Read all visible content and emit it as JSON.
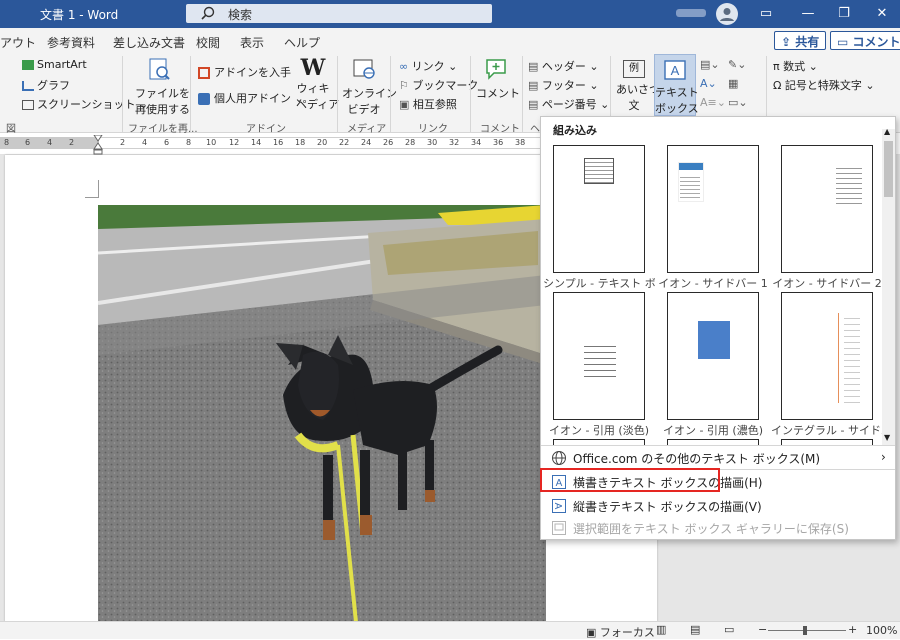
{
  "title": "文書 1 - Word",
  "search_placeholder": "検索",
  "window_buttons": [
    "▭",
    "—",
    "❐",
    "✕"
  ],
  "tabs": [
    "アウト",
    "参考資料",
    "差し込み文書",
    "校閲",
    "表示",
    "ヘルプ"
  ],
  "share_label": "共有",
  "comment_label": "コメント",
  "ribbon": {
    "smartart": "SmartArt",
    "graph": "グラフ",
    "screenshot": "スクリーンショット",
    "reuse_file": [
      "ファイルを",
      "再使用する"
    ],
    "get_addins": "アドインを入手",
    "my_addins": "個人用アドイン",
    "wikipedia": [
      "ウィキ",
      "ペディア"
    ],
    "online_video": [
      "オンライン",
      "ビデオ"
    ],
    "link": "リンク",
    "bookmark": "ブックマーク",
    "crossref": "相互参照",
    "comment": "コメント",
    "header": "ヘッダー",
    "footer": "フッター",
    "page_number": "ページ番号",
    "greeting": [
      "あいさつ",
      "文"
    ],
    "textbox": [
      "テキスト",
      "ボックス"
    ],
    "equation": "数式",
    "symbol": "記号と特殊文字",
    "groups": [
      "図",
      "ファイルを再...",
      "アドイン",
      "メディア",
      "リンク",
      "コメント",
      "ヘ"
    ]
  },
  "ruler_numbers": [
    "8",
    "6",
    "4",
    "2",
    "2",
    "4",
    "6",
    "8",
    "10",
    "12",
    "14",
    "16",
    "18",
    "20",
    "22",
    "24",
    "26",
    "28",
    "30",
    "32",
    "34",
    "36",
    "38"
  ],
  "gallery": {
    "heading": "組み込み",
    "items": [
      "シンプル - テキスト ボックス",
      "イオン - サイドバー 1",
      "イオン - サイドバー 2",
      "イオン - 引用 (淡色)",
      "イオン - 引用 (濃色)",
      "インテグラル - サイドバー"
    ],
    "menu": [
      {
        "label": "Office.com のその他のテキスト ボックス(M)",
        "disabled": false
      },
      {
        "label": "横書きテキスト ボックスの描画(H)",
        "disabled": false
      },
      {
        "label": "縦書きテキスト ボックスの描画(V)",
        "disabled": false
      },
      {
        "label": "選択範囲をテキスト ボックス ギャラリーに保存(S)",
        "disabled": true
      }
    ]
  },
  "status": {
    "focus": "フォーカス",
    "zoom": "100%",
    "minus": "−",
    "plus": "+"
  },
  "colors": {
    "accent": "#2b579a",
    "highlight": "#e52622"
  }
}
